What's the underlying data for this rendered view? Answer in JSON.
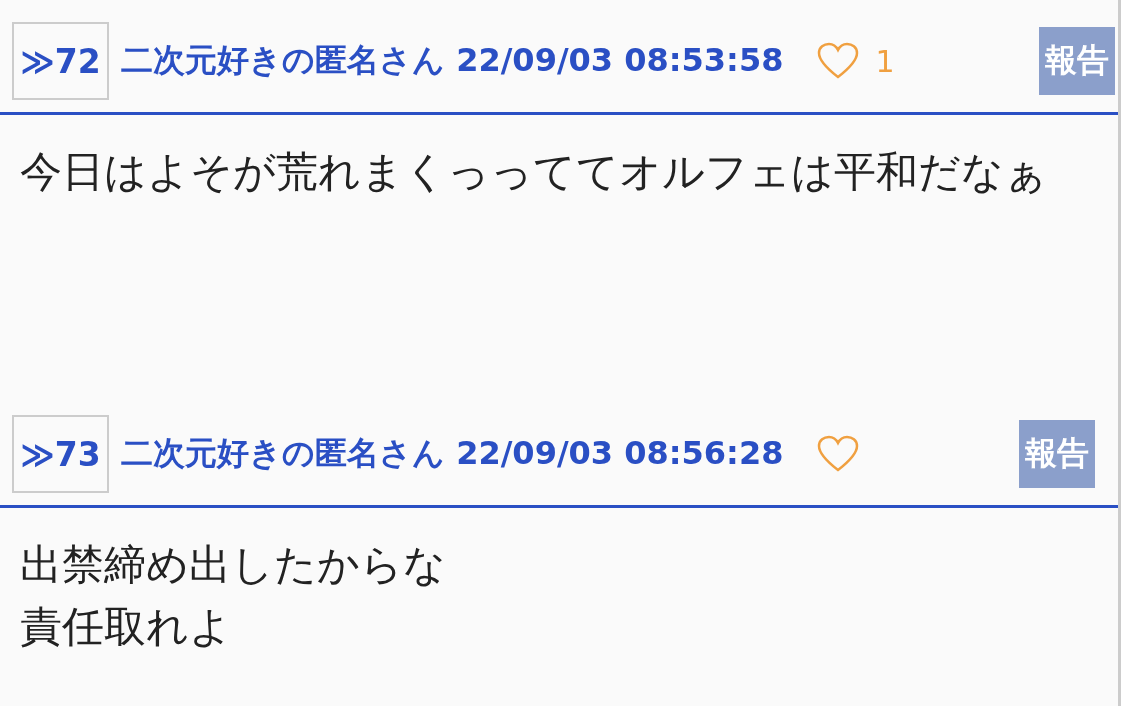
{
  "posts": [
    {
      "number": "≫72",
      "author": "二次元好きの匿名さん",
      "date": "22/09/03 08:53:58",
      "likes": "1",
      "report": "報告",
      "lines": [
        "今日はよそが荒れまくっっててオルフェは平和だなぁ"
      ]
    },
    {
      "number": "≫73",
      "author": "二次元好きの匿名さん",
      "date": "22/09/03 08:56:28",
      "report": "報告",
      "lines": [
        "出禁締め出したからな",
        "責任取れよ"
      ]
    }
  ]
}
